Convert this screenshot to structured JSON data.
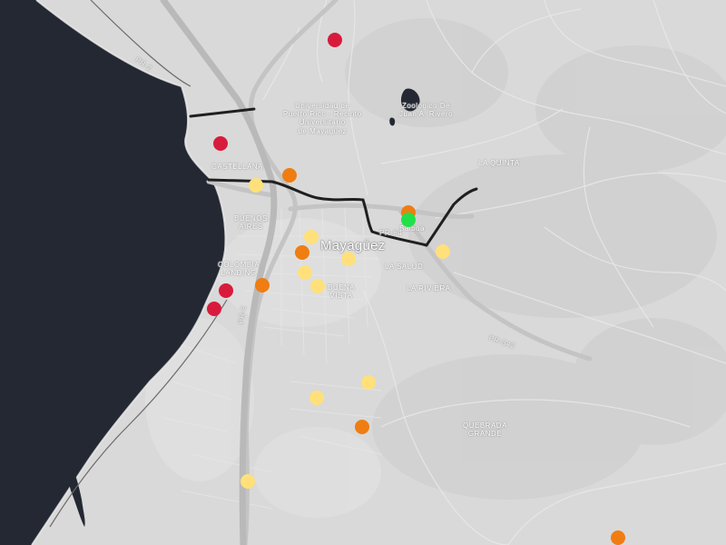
{
  "map": {
    "labels": {
      "univ_1": "Universidad de",
      "univ_2": "Puerto Rico - Recinto",
      "univ_3": "Universitario",
      "univ_4": "de Mayagüez",
      "zoo_1": "Zoológico De",
      "zoo_2": "Juan A. Rivero",
      "la_quinta": "LA QUINTA",
      "castellana": "CASTELLANA",
      "balboa": "Balboa",
      "mayaguez": "Mayagüez",
      "buenos_1": "BUENOS",
      "buenos_2": "AIRES",
      "la_salud": "LA SALUD",
      "la_riviera": "LA RIVIERA",
      "colombia_1": "COLOMBIA",
      "colombia_2": "LANDING",
      "buena_1": "BUENA",
      "buena_2": "VISTA",
      "quebrada_1": "QUEBRADA",
      "quebrada_2": "GRANDE",
      "pr2": "PR-2",
      "pr2_north": "PR-2",
      "pr64": "PR-64",
      "pr342": "PR-342"
    },
    "markers": [
      {
        "status": "red"
      },
      {
        "status": "red"
      },
      {
        "status": "orange"
      },
      {
        "status": "yellow"
      },
      {
        "status": "orange"
      },
      {
        "status": "green"
      },
      {
        "status": "yellow"
      },
      {
        "status": "orange"
      },
      {
        "status": "yellow"
      },
      {
        "status": "yellow"
      },
      {
        "status": "yellow"
      },
      {
        "status": "yellow"
      },
      {
        "status": "orange"
      },
      {
        "status": "red"
      },
      {
        "status": "red"
      },
      {
        "status": "yellow"
      },
      {
        "status": "yellow"
      },
      {
        "status": "orange"
      },
      {
        "status": "yellow"
      },
      {
        "status": "orange"
      }
    ],
    "colors": {
      "red": "#d81b3c",
      "orange": "#ef7d12",
      "yellow": "#ffe07a",
      "green": "#22e04a",
      "sea": "#242833",
      "land": "#d9d9d9",
      "road": "#c2c2c2"
    }
  }
}
